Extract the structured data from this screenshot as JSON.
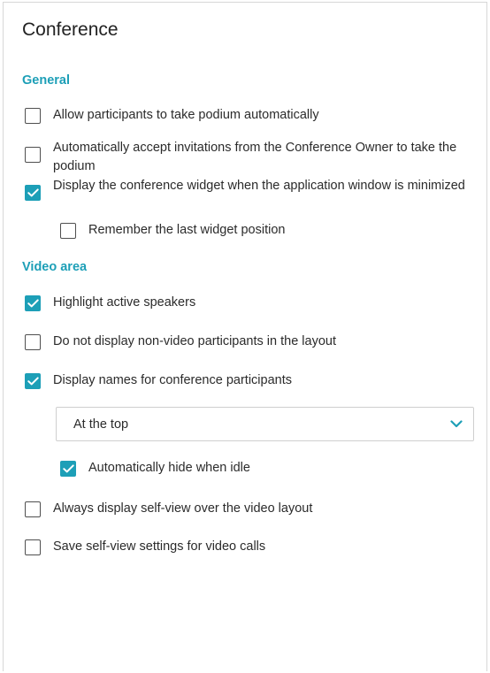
{
  "title": "Conference",
  "sections": {
    "general": "General",
    "video_area": "Video area"
  },
  "options": {
    "allow_podium": {
      "label": "Allow participants to take podium automatically",
      "checked": false
    },
    "accept_invitations": {
      "label": "Automatically accept invitations from the Conference Owner to take the podium",
      "checked": false
    },
    "display_widget": {
      "label": "Display the conference widget when the application window is minimized",
      "checked": true
    },
    "remember_widget_position": {
      "label": "Remember the last widget position",
      "checked": false
    },
    "highlight_speakers": {
      "label": "Highlight active speakers",
      "checked": true
    },
    "hide_non_video": {
      "label": "Do not display non-video participants in the layout",
      "checked": false
    },
    "display_names": {
      "label": "Display names for conference participants",
      "checked": true
    },
    "auto_hide_idle": {
      "label": "Automatically hide when idle",
      "checked": true
    },
    "always_self_view": {
      "label": "Always display self-view over the video layout",
      "checked": false
    },
    "save_self_view": {
      "label": "Save self-view settings for video calls",
      "checked": false
    }
  },
  "names_position": {
    "selected": "At the top"
  },
  "colors": {
    "accent": "#1d9fb7"
  }
}
